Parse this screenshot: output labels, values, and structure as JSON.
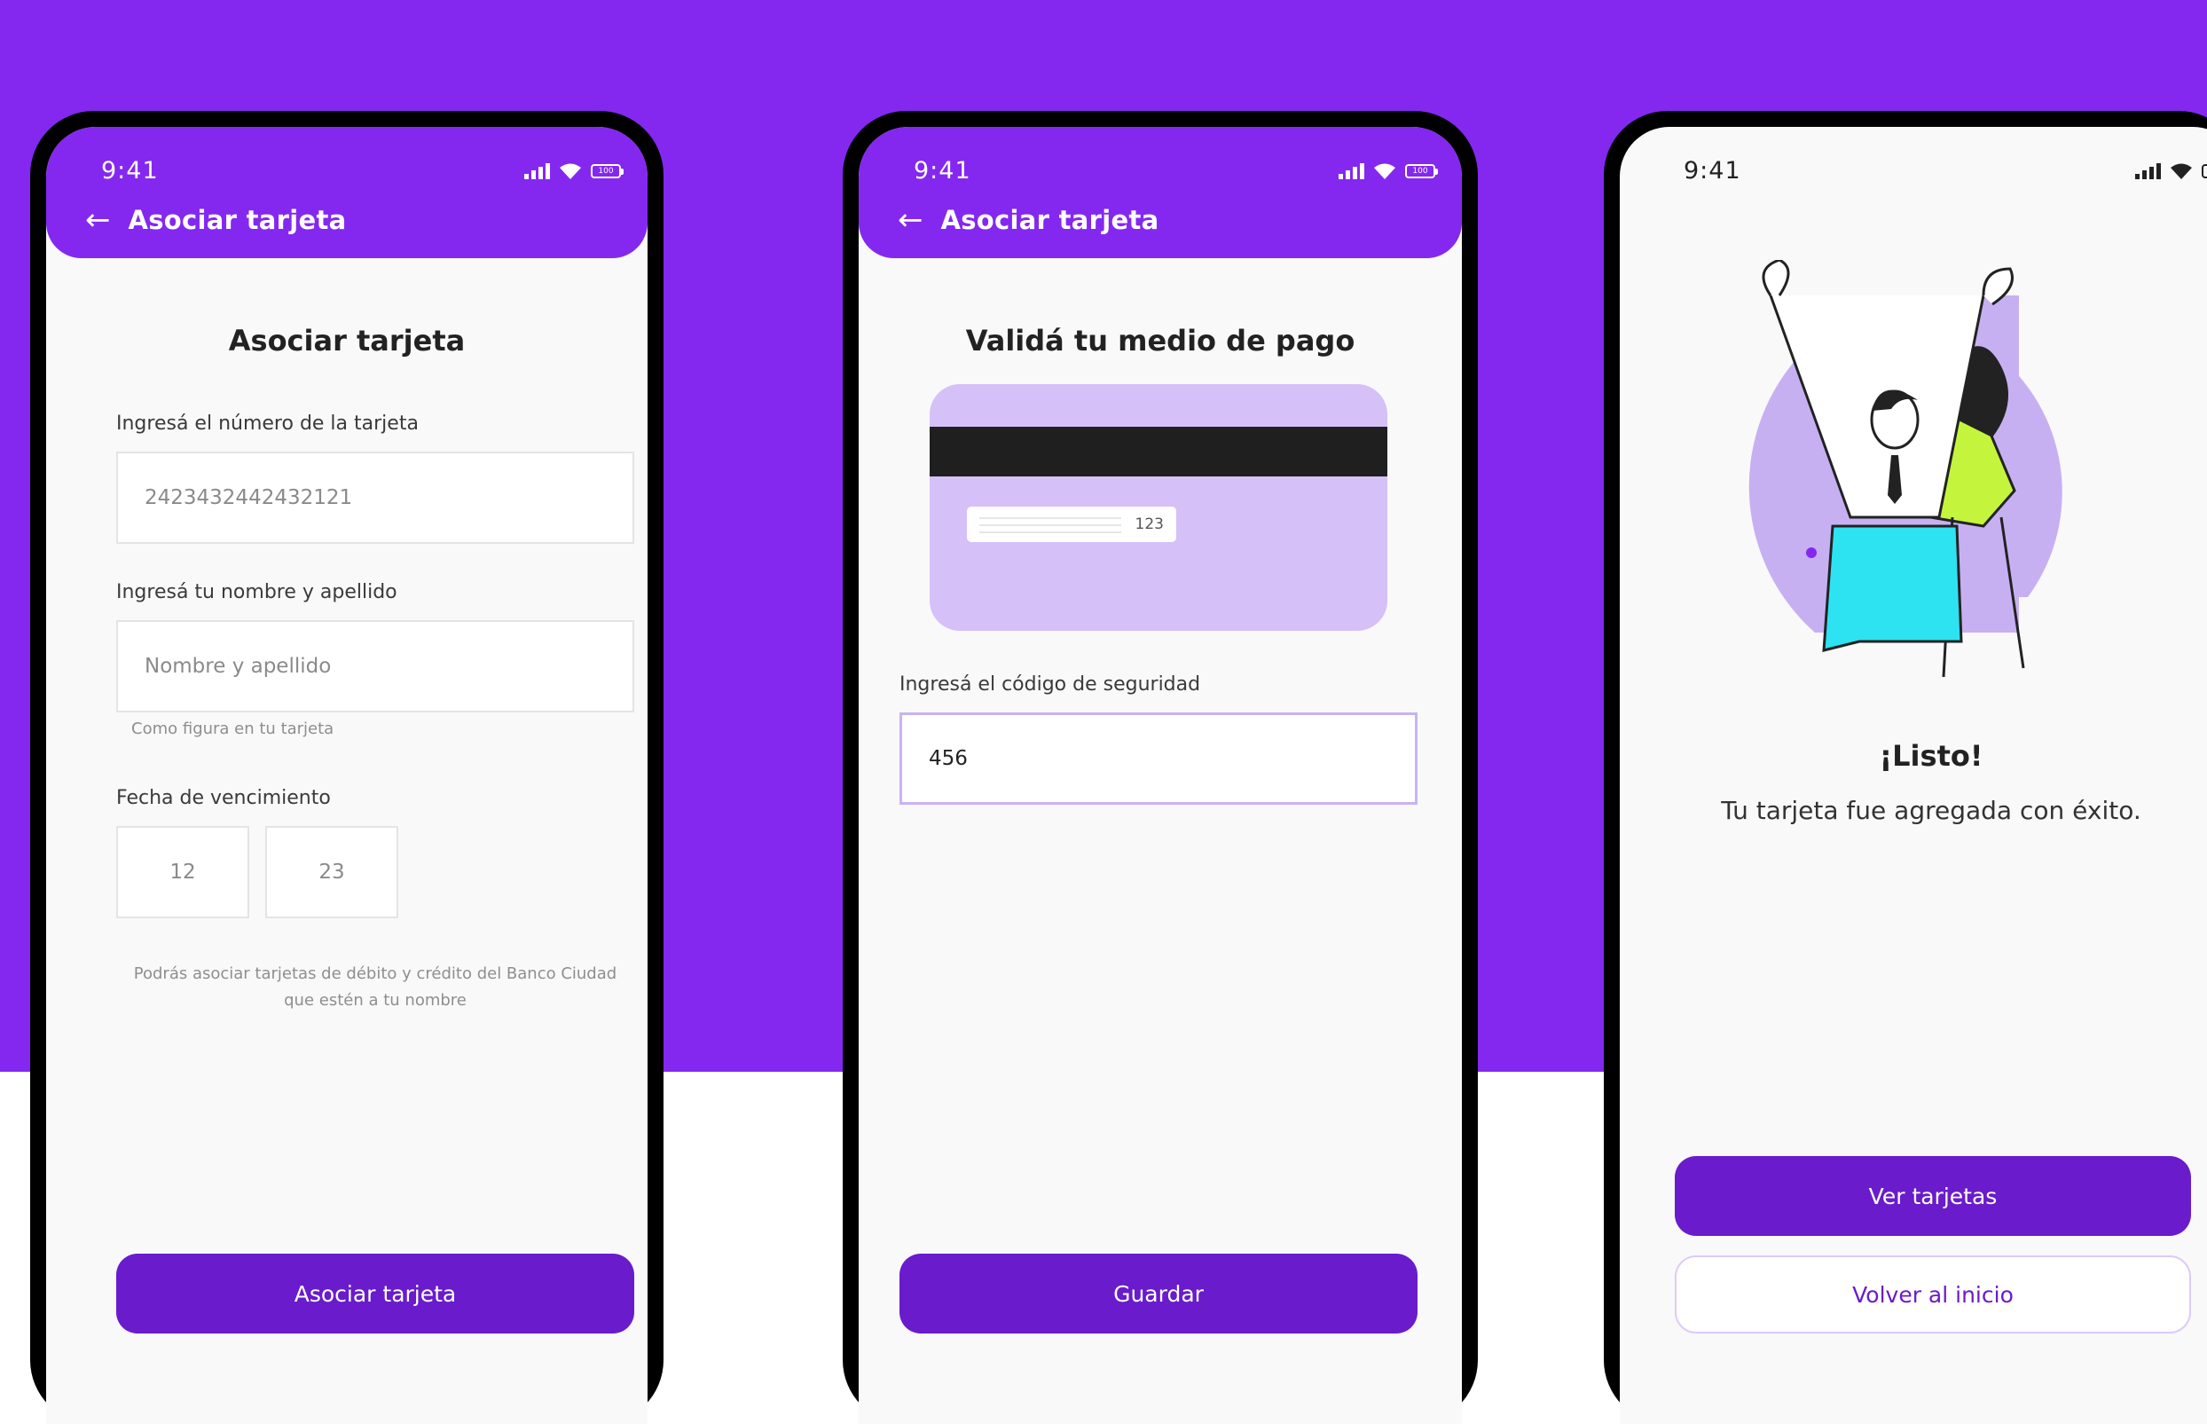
{
  "colors": {
    "brand_purple": "#8428F0",
    "button_purple": "#6A1BCB",
    "card_lilac": "#D6C0F8",
    "accent_green": "#C4F53C",
    "accent_cyan": "#2DE3F2"
  },
  "status_bar": {
    "time": "9:41",
    "battery_level": "100",
    "icons": [
      "signal-icon",
      "wifi-icon",
      "battery-icon"
    ]
  },
  "screens": [
    {
      "header_title": "Asociar tarjeta",
      "title": "Asociar tarjeta",
      "card_number": {
        "label": "Ingresá el número de la tarjeta",
        "value": "2423432442432121"
      },
      "name": {
        "label": "Ingresá tu nombre y apellido",
        "placeholder": "Nombre y apellido",
        "hint": "Como figura en tu tarjeta"
      },
      "expiry": {
        "label": "Fecha de vencimiento",
        "month": "12",
        "year": "23"
      },
      "note": "Podrás asociar tarjetas de débito y crédito del Banco Ciudad que estén a tu nombre",
      "button": "Asociar tarjeta"
    },
    {
      "header_title": "Asociar tarjeta",
      "title": "Validá tu medio de pago",
      "card_cvv_preview": "123",
      "security_code": {
        "label": "Ingresá el código de seguridad",
        "value": "456"
      },
      "button": "Guardar"
    },
    {
      "illustration": "celebrating-people-illustration",
      "title": "¡Listo!",
      "message": "Tu tarjeta fue agregada con éxito.",
      "primary_button": "Ver tarjetas",
      "secondary_button": "Volver al inicio"
    }
  ]
}
